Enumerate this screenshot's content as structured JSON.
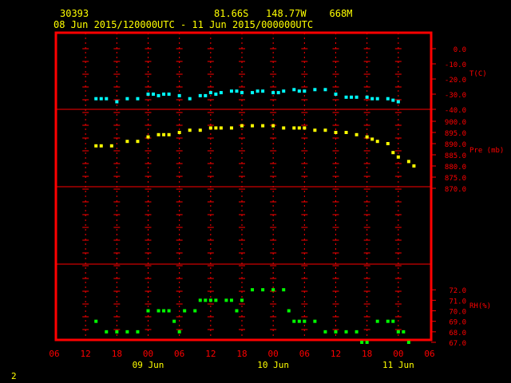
{
  "header": {
    "station_id": "30393",
    "location": "81.66S   148.77W    668M",
    "time_range": "08 Jun 2015/120000UTC - 11 Jun 2015/000000UTC"
  },
  "footer": {
    "page_number": "2"
  },
  "colors": {
    "frame": "#ff0000",
    "grid": "#ff0000",
    "axis_text": "#ff0000",
    "time_text": "#ffff00",
    "header_text": "#ffff00",
    "temperature": "#00ffff",
    "pressure": "#ffff00",
    "humidity": "#00ff00"
  },
  "chart_data": [
    {
      "type": "scatter",
      "ylabel": "T(C)",
      "ylim": [
        -40,
        0
      ],
      "yticks": [
        "0.0",
        "-10.0",
        "-20.0",
        "-30.0",
        "-40.0"
      ],
      "xlim": [
        6,
        78
      ],
      "series": [
        {
          "x": [
            14,
            15,
            16,
            18,
            20,
            22,
            24,
            25,
            26,
            27,
            28,
            30,
            32,
            34,
            35,
            36,
            37,
            38,
            40,
            41,
            42,
            44,
            45,
            46,
            48,
            49,
            50,
            52,
            53,
            54,
            56,
            58,
            60,
            62,
            63,
            64,
            66,
            67,
            68,
            70,
            71,
            72
          ],
          "y": [
            -33,
            -33,
            -33,
            -35,
            -33,
            -33,
            -30,
            -30,
            -31,
            -30,
            -30,
            -31,
            -33,
            -31,
            -31,
            -29,
            -30,
            -29,
            -28,
            -28,
            -29,
            -29,
            -28,
            -28,
            -29,
            -29,
            -28,
            -27,
            -28,
            -28,
            -27,
            -27,
            -30,
            -32,
            -32,
            -32,
            -32,
            -33,
            -33,
            -33,
            -34,
            -35
          ]
        }
      ]
    },
    {
      "type": "scatter",
      "ylabel": "Pre (mb)",
      "ylim": [
        870,
        900
      ],
      "yticks": [
        "900.0",
        "895.0",
        "890.0",
        "885.0",
        "880.0",
        "875.0",
        "870.0"
      ],
      "xlim": [
        6,
        78
      ],
      "series": [
        {
          "x": [
            14,
            15,
            17,
            20,
            22,
            24,
            26,
            27,
            28,
            30,
            32,
            34,
            36,
            37,
            38,
            40,
            42,
            44,
            46,
            48,
            50,
            52,
            53,
            54,
            56,
            58,
            60,
            62,
            64,
            66,
            67,
            68,
            70,
            71,
            72,
            74,
            75
          ],
          "y": [
            889,
            889,
            889,
            891,
            891,
            893,
            894,
            894,
            894,
            895,
            896,
            896,
            897,
            897,
            897,
            897,
            898,
            898,
            898,
            898,
            897,
            897,
            897,
            897,
            896,
            896,
            895,
            895,
            894,
            893,
            892,
            891,
            890,
            886,
            884,
            882,
            880
          ]
        }
      ]
    },
    {
      "type": "scatter",
      "ylabel": "RH(%)",
      "ylim": [
        67,
        73
      ],
      "yticks": [
        "72.0",
        "71.0",
        "70.0",
        "69.0",
        "68.0",
        "67.0"
      ],
      "xlim": [
        6,
        78
      ],
      "series": [
        {
          "x": [
            14,
            16,
            18,
            20,
            22,
            24,
            26,
            27,
            28,
            29,
            30,
            31,
            33,
            34,
            35,
            36,
            37,
            39,
            40,
            41,
            42,
            44,
            46,
            48,
            50,
            51,
            52,
            53,
            54,
            56,
            58,
            60,
            62,
            64,
            65,
            66,
            68,
            70,
            71,
            72,
            73,
            74
          ],
          "y": [
            69,
            68,
            68,
            68,
            68,
            70,
            70,
            70,
            70,
            69,
            68,
            70,
            70,
            71,
            71,
            71,
            71,
            71,
            71,
            70,
            71,
            72,
            72,
            72,
            72,
            70,
            69,
            69,
            69,
            69,
            68,
            68,
            68,
            68,
            67,
            67,
            69,
            69,
            69,
            68,
            68,
            67
          ]
        }
      ]
    }
  ],
  "x_axis": {
    "ticks": [
      {
        "hour": 6,
        "label": "06"
      },
      {
        "hour": 12,
        "label": "12"
      },
      {
        "hour": 18,
        "label": "18"
      },
      {
        "hour": 24,
        "label": "00"
      },
      {
        "hour": 30,
        "label": "06"
      },
      {
        "hour": 36,
        "label": "12"
      },
      {
        "hour": 42,
        "label": "18"
      },
      {
        "hour": 48,
        "label": "00"
      },
      {
        "hour": 54,
        "label": "06"
      },
      {
        "hour": 60,
        "label": "12"
      },
      {
        "hour": 66,
        "label": "18"
      },
      {
        "hour": 72,
        "label": "00"
      },
      {
        "hour": 78,
        "label": "06"
      }
    ],
    "day_labels": [
      {
        "hour": 24,
        "label": "09 Jun"
      },
      {
        "hour": 48,
        "label": "10 Jun"
      },
      {
        "hour": 72,
        "label": "11 Jun"
      }
    ]
  }
}
